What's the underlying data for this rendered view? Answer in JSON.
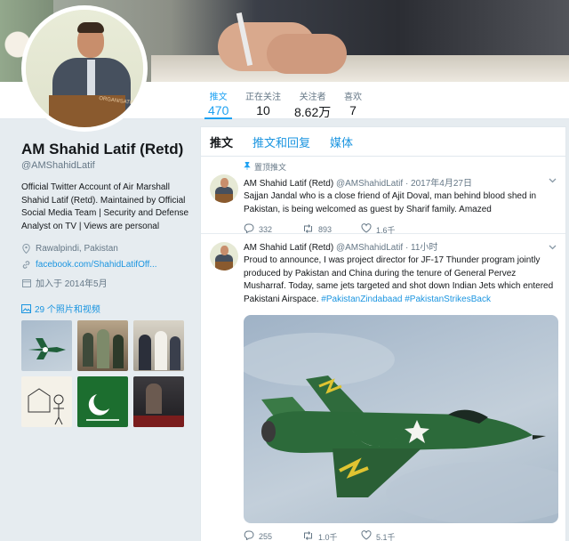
{
  "profile": {
    "name": "AM Shahid Latif (Retd)",
    "handle": "@AMShahidLatif",
    "bio": "Official Twitter Account of Air Marshall Shahid Latif (Retd). Maintained by Official Social Media Team | Security and Defense Analyst on TV | Views are personal",
    "location": "Rawalpindi, Pakistan",
    "website": "facebook.com/ShahidLatifOff...",
    "joined": "加入于 2014年5月",
    "photos_link": "29 个照片和视频",
    "avatar_podium_text": "ORGANISATION"
  },
  "nav": {
    "stats": [
      {
        "label": "推文",
        "value": "470"
      },
      {
        "label": "正在关注",
        "value": "10"
      },
      {
        "label": "关注者",
        "value": "8.62万"
      },
      {
        "label": "喜欢",
        "value": "7"
      }
    ]
  },
  "timeline": {
    "tabs": [
      {
        "label": "推文"
      },
      {
        "label": "推文和回复"
      },
      {
        "label": "媒体"
      }
    ],
    "tweets": [
      {
        "pinned_label": "置顶推文",
        "name": "AM Shahid Latif (Retd)",
        "handle": "@AMShahidLatif",
        "time": "· 2017年4月27日",
        "text": "Sajjan Jandal who is a close friend of Ajit Doval, man behind blood shed in Pakistan, is being welcomed as guest by Sharif family. Amazed",
        "replies": "332",
        "retweets": "893",
        "likes": "1.6千"
      },
      {
        "name": "AM Shahid Latif (Retd)",
        "handle": "@AMShahidLatif",
        "time": "· 11小时",
        "text": "Proud to announce, I was project director for JF-17 Thunder program jointly produced by Pakistan and China during the tenure of General Pervez Musharraf. Today, same jets targeted and shot down Indian Jets which entered Pakistani Airspace.",
        "hashtag1": "#PakistanZindabaad",
        "hashtag2": "#PakistanStrikesBack",
        "replies": "255",
        "retweets": "1.0千",
        "likes": "5.1千"
      }
    ]
  },
  "icons": {
    "location": "location-pin-icon",
    "link": "link-icon",
    "calendar": "calendar-icon",
    "photos": "photo-icon",
    "reply": "reply-icon",
    "retweet": "retweet-icon",
    "like": "heart-icon",
    "pin": "pin-icon",
    "chevron": "chevron-down-icon"
  },
  "colors": {
    "accent": "#1da1f2",
    "link": "#1b95e0",
    "background": "#e6ecf0"
  }
}
